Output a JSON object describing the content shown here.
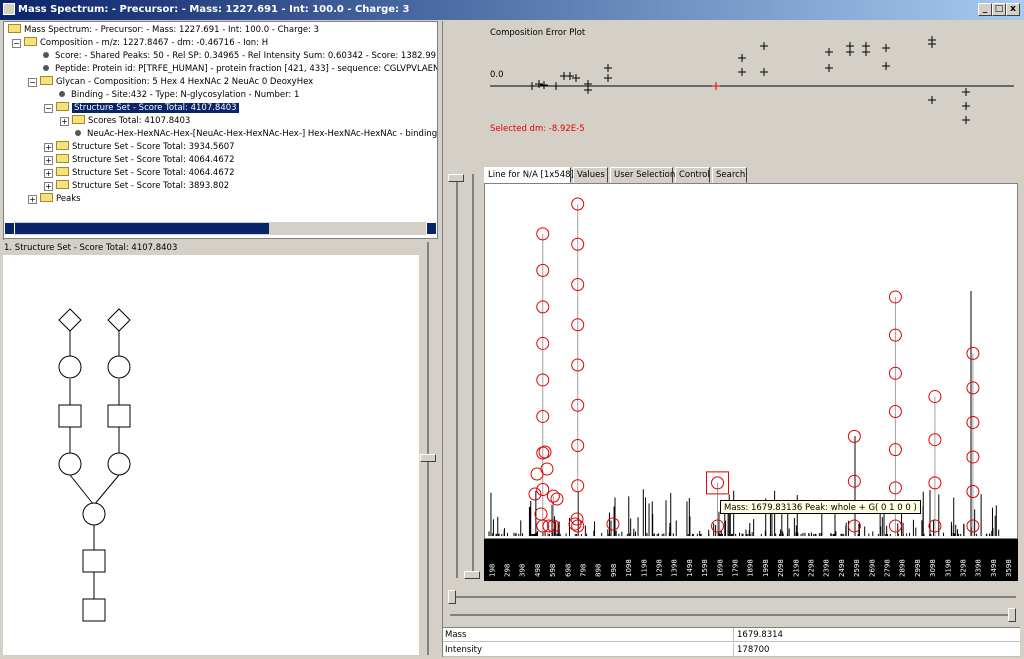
{
  "window": {
    "title": "Mass Spectrum:  - Precursor:  - Mass: 1227.691 - Int: 100.0 - Charge: 3",
    "min_glyph": "_",
    "max_glyph": "□",
    "close_glyph": "x"
  },
  "tree": {
    "items": [
      {
        "label": "Mass Spectrum:  - Precursor:  - Mass: 1227.691 - Int: 100.0 - Charge: 3"
      },
      {
        "label": "Composition - m/z: 1227.8467 - dm: -0.46716 - Ion: H"
      },
      {
        "label": "Score:  - Shared Peaks: 50 - Rel SP: 0.34965 - Rel Intensity Sum: 0.60342 - Score: 1382.9916"
      },
      {
        "label": "Peptide:  Protein id: P[TRFE_HUMAN] - protein fraction [421, 433] - sequence: CGLVPVLAENYNK -"
      },
      {
        "label": "Glycan - Composition: 5 Hex 4 HexNAc 2 NeuAc 0 DeoxyHex"
      },
      {
        "label": "Binding - Site:432 - Type: N-glycosylation - Number: 1"
      },
      {
        "label": "Structure Set - Score Total: 4107.8403"
      },
      {
        "label": "Scores Total: 4107.8403"
      },
      {
        "label": "NeuAc-Hex-HexNAc-Hex-[NeuAc-Hex-HexNAc-Hex-] Hex-HexNAc-HexNAc - bindings: ["
      },
      {
        "label": "Structure Set - Score Total: 3934.5607"
      },
      {
        "label": "Structure Set - Score Total: 4064.4672"
      },
      {
        "label": "Structure Set - Score Total: 4064.4672"
      },
      {
        "label": "Structure Set - Score Total: 3893.802"
      },
      {
        "label": "Peaks"
      }
    ]
  },
  "structure_panel": {
    "label": "1. Structure Set - Score Total: 4107.8403"
  },
  "error_plot": {
    "title": "Composition Error Plot",
    "zero_label": "0.0",
    "selected_label": "Selected dm: -8.92E-5"
  },
  "tabs": [
    {
      "label": "Line for N/A [1x548]",
      "active": true
    },
    {
      "label": "Values",
      "active": false
    },
    {
      "label": "User Selection",
      "active": false
    },
    {
      "label": "Control",
      "active": false
    },
    {
      "label": "Search",
      "active": false
    }
  ],
  "tooltip": {
    "text": "Mass: 1679.83136 Peak: whole + G( 0 1 0 0 )"
  },
  "info": {
    "rows": [
      {
        "key": "Mass",
        "value": "1679.8314"
      },
      {
        "key": "Intensity",
        "value": "178700"
      }
    ]
  },
  "chart_data": {
    "type": "bar",
    "x_ticks": [
      "198",
      "298",
      "398",
      "498",
      "598",
      "698",
      "798",
      "898",
      "998",
      "1098",
      "1198",
      "1298",
      "1398",
      "1498",
      "1598",
      "1698",
      "1798",
      "1898",
      "1998",
      "2098",
      "2198",
      "2298",
      "2398",
      "2498",
      "2598",
      "2698",
      "2798",
      "2898",
      "2998",
      "3098",
      "3198",
      "3298",
      "3398",
      "3498",
      "3598"
    ],
    "xlim": [
      150,
      3650
    ],
    "ylim": [
      0,
      1
    ],
    "matched_peaks": [
      {
        "x": 530,
        "y": 0.91
      },
      {
        "x": 600,
        "y": 0.12
      },
      {
        "x": 760,
        "y": 1.0
      },
      {
        "x": 1679.8314,
        "y": 0.16
      },
      {
        "x": 2580,
        "y": 0.3
      },
      {
        "x": 2850,
        "y": 0.72
      },
      {
        "x": 3110,
        "y": 0.42
      },
      {
        "x": 3360,
        "y": 0.55
      }
    ],
    "colors": {
      "matched": "#e00000",
      "stem": "#a0a0a0",
      "raw": "#000000"
    }
  }
}
